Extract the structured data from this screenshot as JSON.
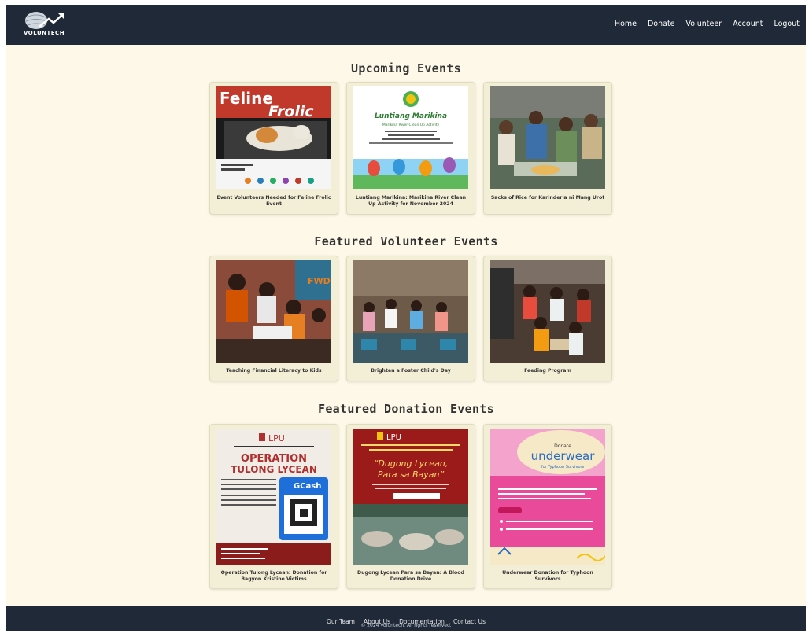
{
  "brand": {
    "name": "VOLUNTECH"
  },
  "nav": {
    "items": [
      {
        "label": "Home"
      },
      {
        "label": "Donate"
      },
      {
        "label": "Volunteer"
      },
      {
        "label": "Account"
      },
      {
        "label": "Logout"
      }
    ]
  },
  "sections": [
    {
      "title": "Upcoming Events",
      "cards": [
        {
          "caption": "Event Volunteers Needed for Feline Frolic Event",
          "poster_title_1": "Feline",
          "poster_title_2": "Frolic"
        },
        {
          "caption": "Luntiang Marikina: Marikina River Clean Up Activity for November 2024",
          "poster_title_1": "Luntiang Marikina",
          "poster_title_2": "Marikina River Clean Up Activity"
        },
        {
          "caption": "Sacks of Rice for Karinderia ni Mang Urot"
        }
      ]
    },
    {
      "title": "Featured Volunteer Events",
      "cards": [
        {
          "caption": "Teaching Financial Literacy to Kids"
        },
        {
          "caption": "Brighten a Foster Child's Day"
        },
        {
          "caption": "Feeding Program"
        }
      ]
    },
    {
      "title": "Featured Donation Events",
      "cards": [
        {
          "caption": "Operation Tulong Lycean: Donation for Bagyon Kristine Victims",
          "poster_logo": "LPU",
          "poster_title_1": "OPERATION",
          "poster_title_2": "TULONG LYCEAN",
          "poster_pay": "GCash"
        },
        {
          "caption": "Dugong Lycean Para sa Bayan: A Blood Donation Drive",
          "poster_logo": "LPU",
          "poster_title_1": "“Dugong Lycean,",
          "poster_title_2": "Para sa Bayan”"
        },
        {
          "caption": "Underwear Donation for Typhoon Survivors",
          "poster_title_1": "Donate",
          "poster_title_2": "underwear",
          "poster_title_3": "for Typhoon Survivors"
        }
      ]
    }
  ],
  "footer": {
    "links": [
      {
        "label": "Our Team"
      },
      {
        "label": "About Us"
      },
      {
        "label": "Documentation"
      },
      {
        "label": "Contact Us"
      }
    ],
    "copyright": "© 2024 Voluntech. All rights reserved."
  },
  "colors": {
    "navbar": "#1f2937",
    "page_background": "#fdf8e8",
    "card_background": "#f3eed6"
  },
  "icons": {
    "logo": "voluntech-globe-arrow-logo"
  }
}
